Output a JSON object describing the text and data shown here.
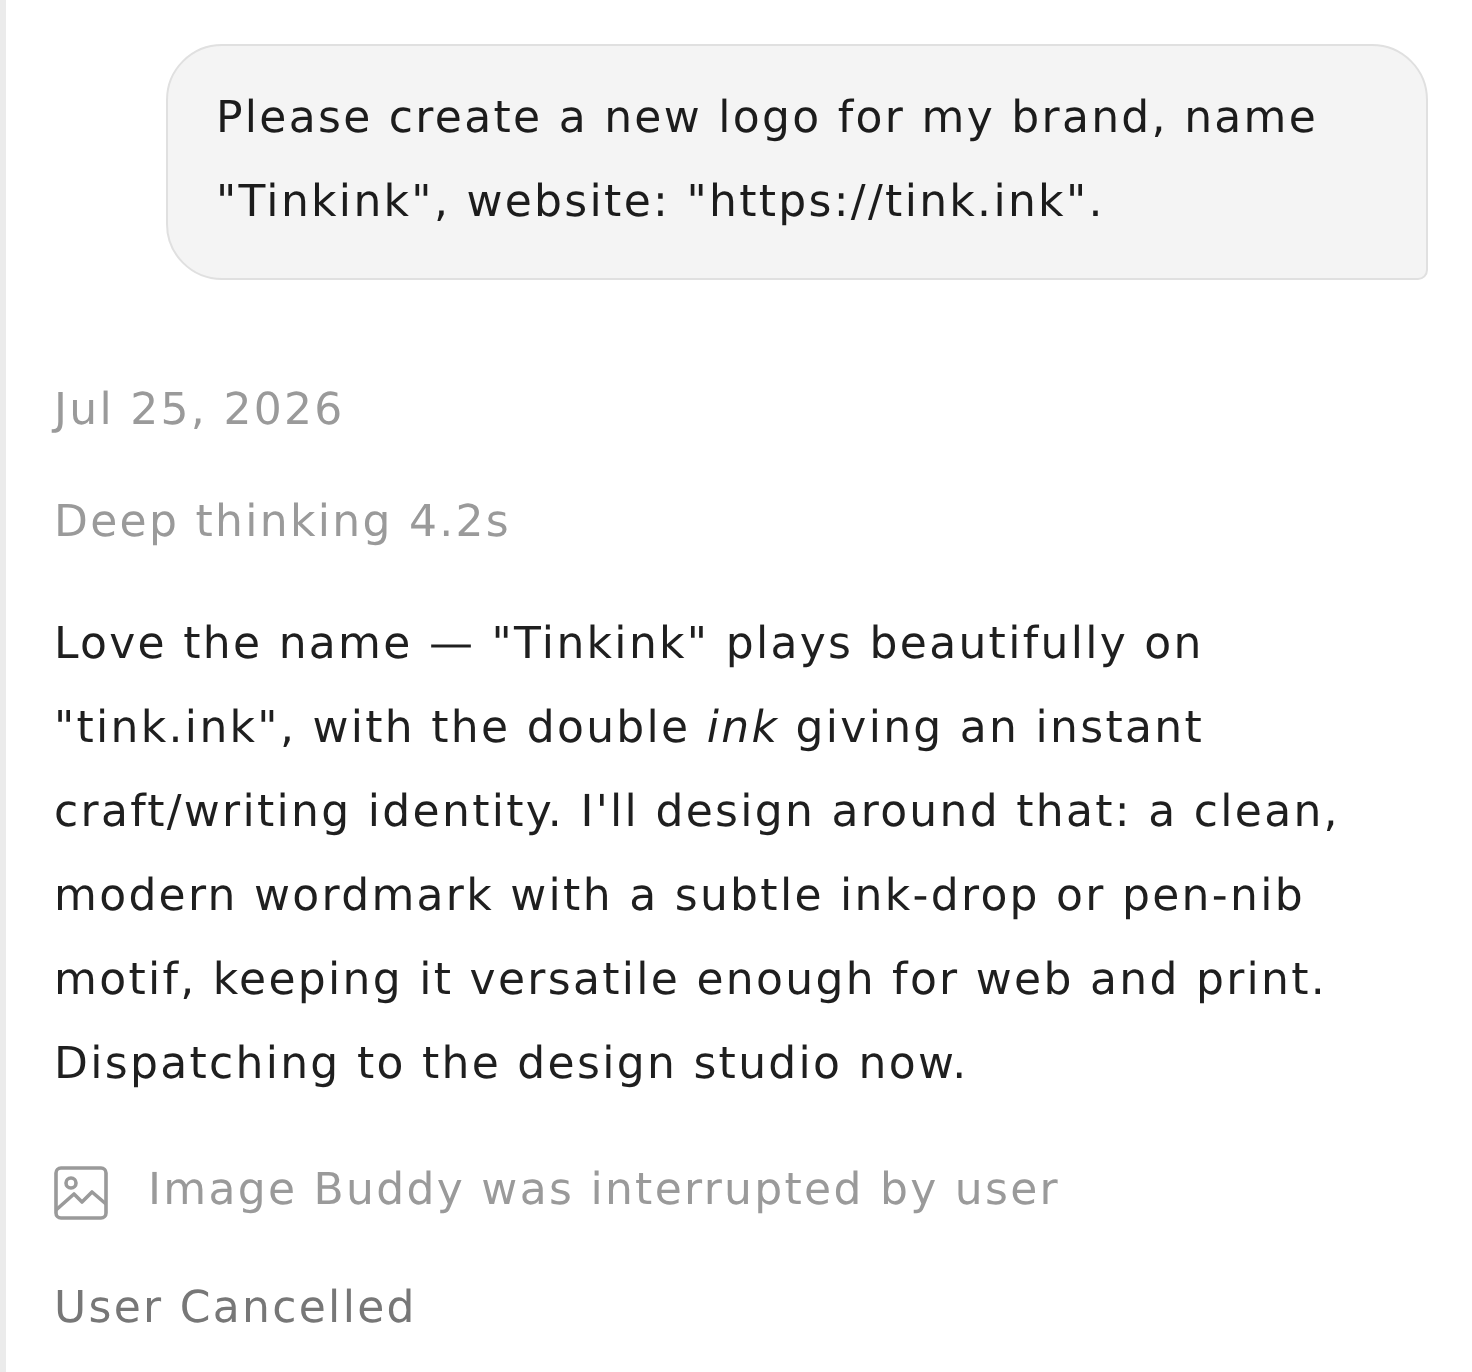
{
  "user_message": {
    "text": "Please create a new logo for my brand, name \"Tinkink\", website: \"https://tink.ink\"."
  },
  "reply": {
    "date": "Jul 25, 2026",
    "thinking": "Deep thinking 4.2s",
    "text": "Love the name — \"Tinkink\" plays beautifully on \"tink.ink\", with the double *ink* giving an instant craft/writing identity. I'll design around that: a clean, modern wordmark with a subtle ink-drop or pen-nib motif, keeping it versatile enough for web and print. Dispatching to the design studio now.",
    "tool_call": {
      "label": "Image Buddy was interrupted by user"
    },
    "status": "User Cancelled"
  }
}
